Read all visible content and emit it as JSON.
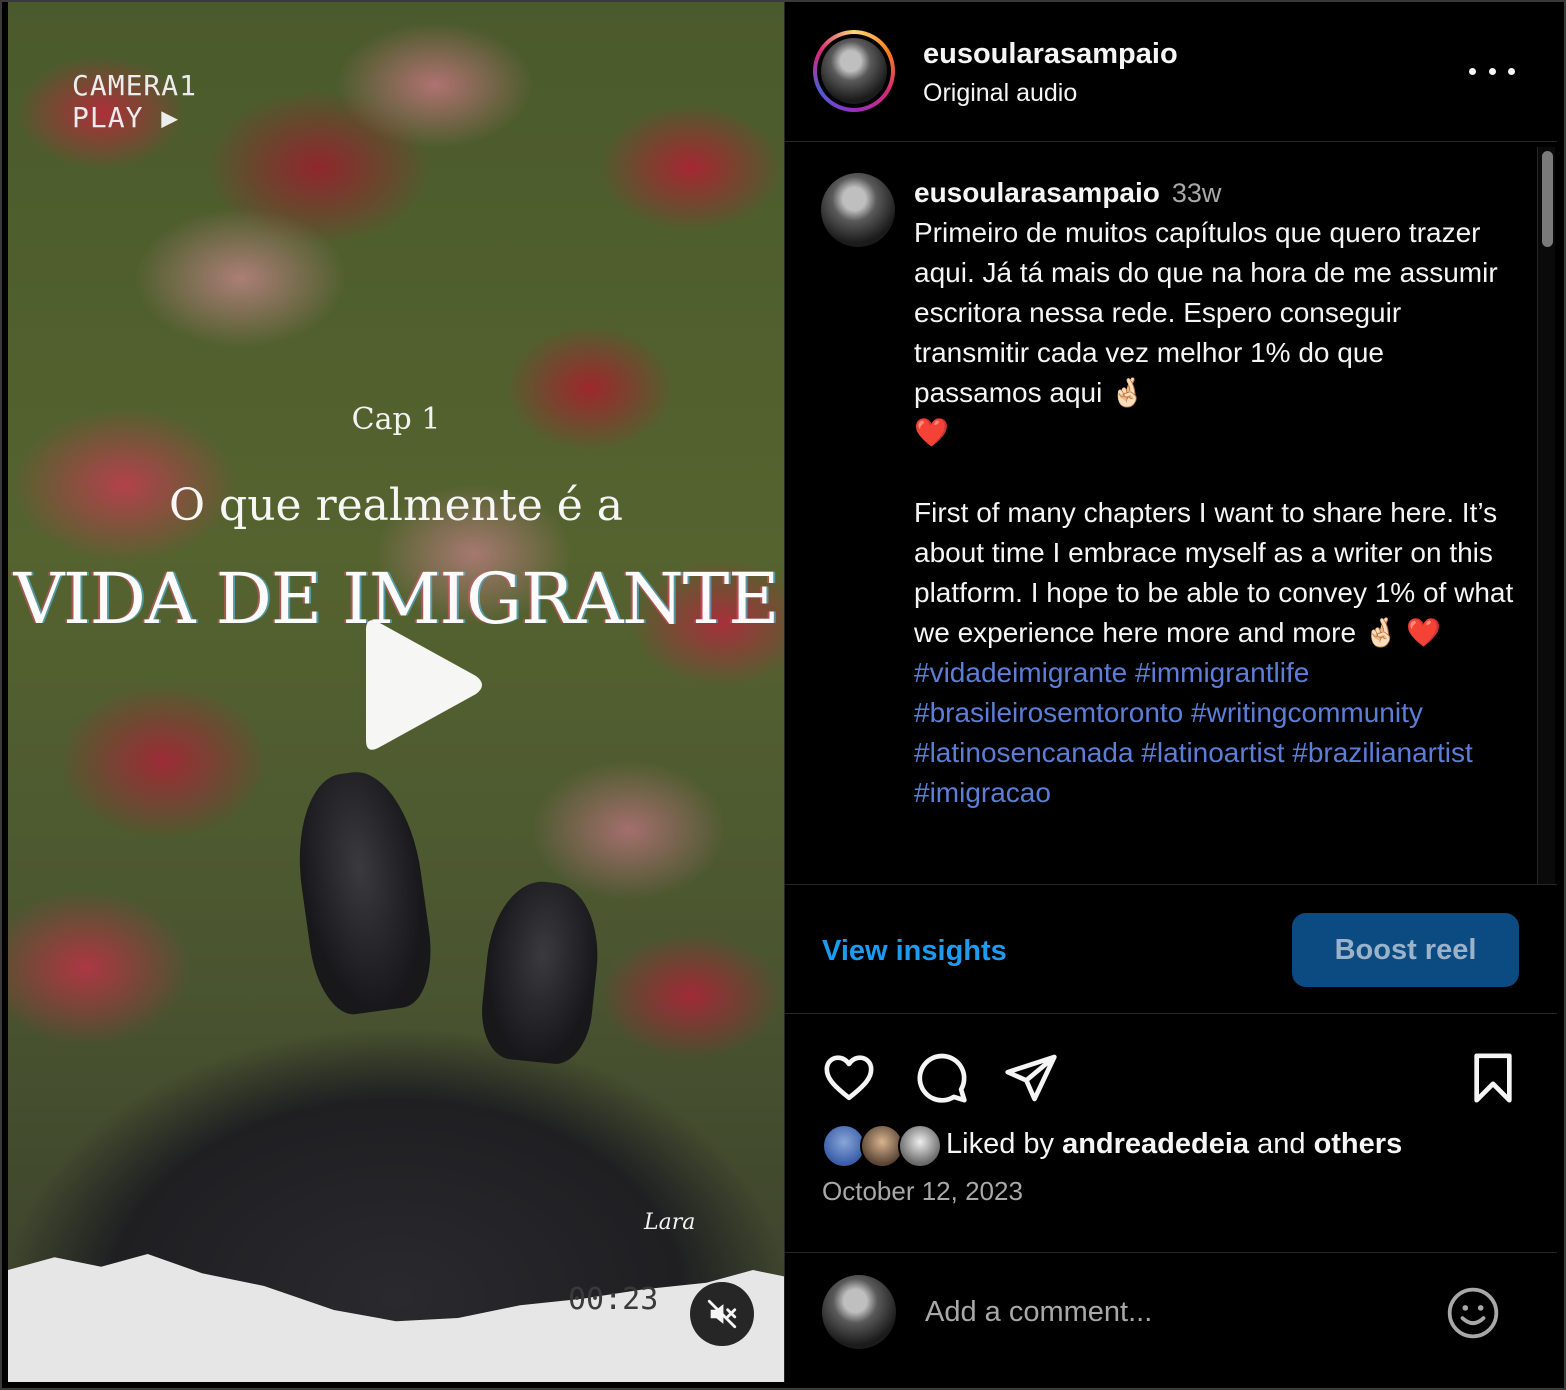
{
  "media": {
    "overlay_camera": "CAMERA1",
    "overlay_play": "PLAY ▶",
    "chapter": "Cap 1",
    "subtitle": "O que realmente é a",
    "title": "VIDA DE IMIGRANTE",
    "signature": "Lara",
    "timer": "00:23",
    "play_icon": "play-icon",
    "mute_icon": "muted-speaker-icon"
  },
  "header": {
    "username": "eusoularasampaio",
    "audio": "Original audio",
    "more_icon": "more-options-icon"
  },
  "caption": {
    "username": "eusoularasampaio",
    "time": "33w",
    "text": "Primeiro de muitos capítulos que quero trazer aqui. Já tá mais do que na hora de me assumir escritora nessa rede. Espero conseguir transmitir cada vez melhor 1% do que passamos aqui 🤞🏻\n❤️\n\nFirst of many chapters I want to share here. It’s about time I embrace myself as a writer on this platform. I hope to be able to convey 1% of what we experience here more and more 🤞🏻 ❤️\n",
    "hashtags": "#vidadeimigrante #immigrantlife #brasileirosemtoronto #writingcommunity #latinosencanada #latinoartist #brazilianartist #imigracao"
  },
  "actions": {
    "view_insights": "View insights",
    "boost": "Boost reel",
    "accent": "#1d9bf0",
    "boost_bg": "#0c4a82"
  },
  "icons": [
    "heart-icon",
    "comment-icon",
    "share-icon",
    "bookmark-icon"
  ],
  "likes": {
    "prefix": "Liked by ",
    "user": "andreadedeia",
    "connector": " and ",
    "others": "others"
  },
  "date": "October 12, 2023",
  "comment_box": {
    "placeholder": "Add a comment...",
    "emoji_icon": "emoji-icon"
  }
}
